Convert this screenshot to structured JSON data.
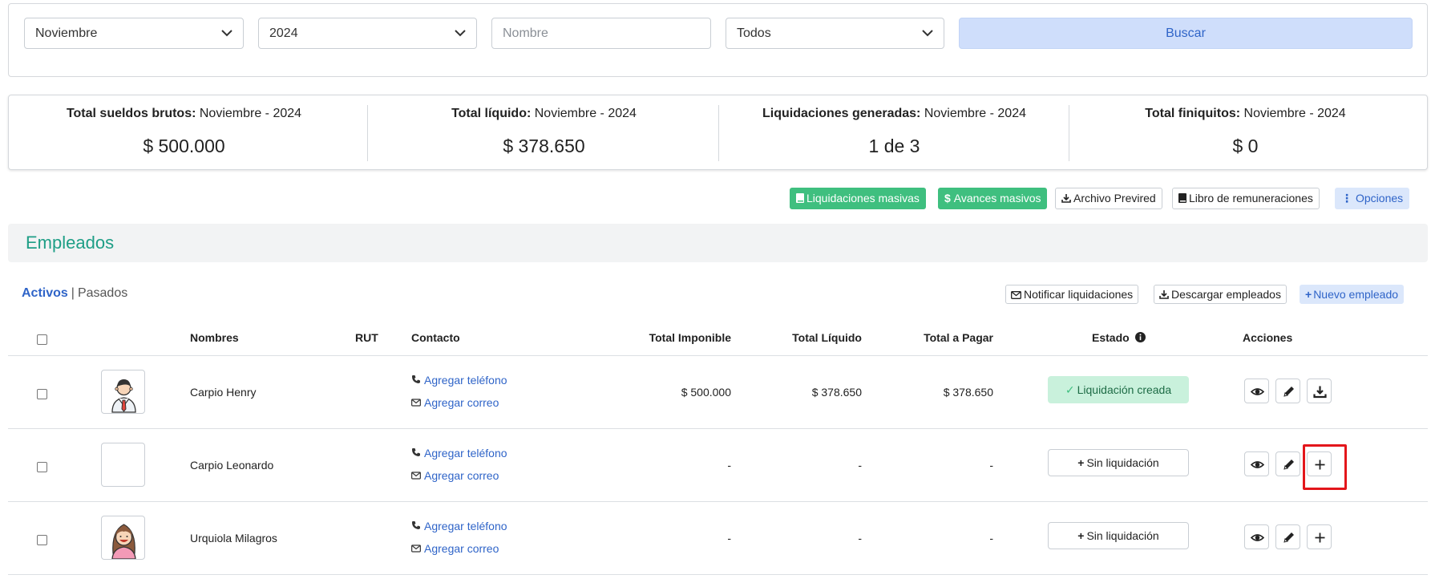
{
  "filters": {
    "month": "Noviembre",
    "year": "2024",
    "name_placeholder": "Nombre",
    "status": "Todos",
    "search_label": "Buscar"
  },
  "stats": [
    {
      "label": "Total sueldos brutos:",
      "period": " Noviembre - 2024",
      "value": "$ 500.000"
    },
    {
      "label": "Total líquido:",
      "period": " Noviembre - 2024",
      "value": "$ 378.650"
    },
    {
      "label": "Liquidaciones generadas:",
      "period": " Noviembre - 2024",
      "value": "1 de 3"
    },
    {
      "label": "Total finiquitos:",
      "period": " Noviembre - 2024",
      "value": "$ 0"
    }
  ],
  "actions": {
    "mass_payslips": "Liquidaciones masivas",
    "mass_advances": "Avances masivos",
    "previred_file": "Archivo Previred",
    "payroll_book": "Libro de remuneraciones",
    "options": "Opciones"
  },
  "section_title": "Empleados",
  "tabs": {
    "active": "Activos",
    "separator": "|",
    "past": "Pasados"
  },
  "tools": {
    "notify": "Notificar liquidaciones",
    "download": "Descargar empleados",
    "new_employee": "Nuevo empleado"
  },
  "table": {
    "headers": {
      "names": "Nombres",
      "rut": "RUT",
      "contact": "Contacto",
      "taxable": "Total Imponible",
      "net": "Total Líquido",
      "to_pay": "Total a Pagar",
      "status": "Estado",
      "actions": "Acciones"
    },
    "rows": [
      {
        "name": "Carpio Henry",
        "phone": "Agregar teléfono",
        "email": "Agregar correo",
        "taxable": "$ 500.000",
        "net": "$ 378.650",
        "to_pay": "$ 378.650",
        "status": "Liquidación creada",
        "avatar": "man-avatar"
      },
      {
        "name": "Carpio Leonardo",
        "phone": "Agregar teléfono",
        "email": "Agregar correo",
        "taxable": "-",
        "net": "-",
        "to_pay": "-",
        "status": "Sin liquidación",
        "avatar": "empty"
      },
      {
        "name": "Urquiola Milagros",
        "phone": "Agregar teléfono",
        "email": "Agregar correo",
        "taxable": "-",
        "net": "-",
        "to_pay": "-",
        "status": "Sin liquidación",
        "avatar": "woman-avatar"
      }
    ]
  },
  "colors": {
    "accent": "#2f64c8",
    "section_title": "#1e9e86",
    "green_button": "#3fbf7f",
    "status_ok_bg": "#c9f1dc",
    "highlight": "#e3161b"
  }
}
